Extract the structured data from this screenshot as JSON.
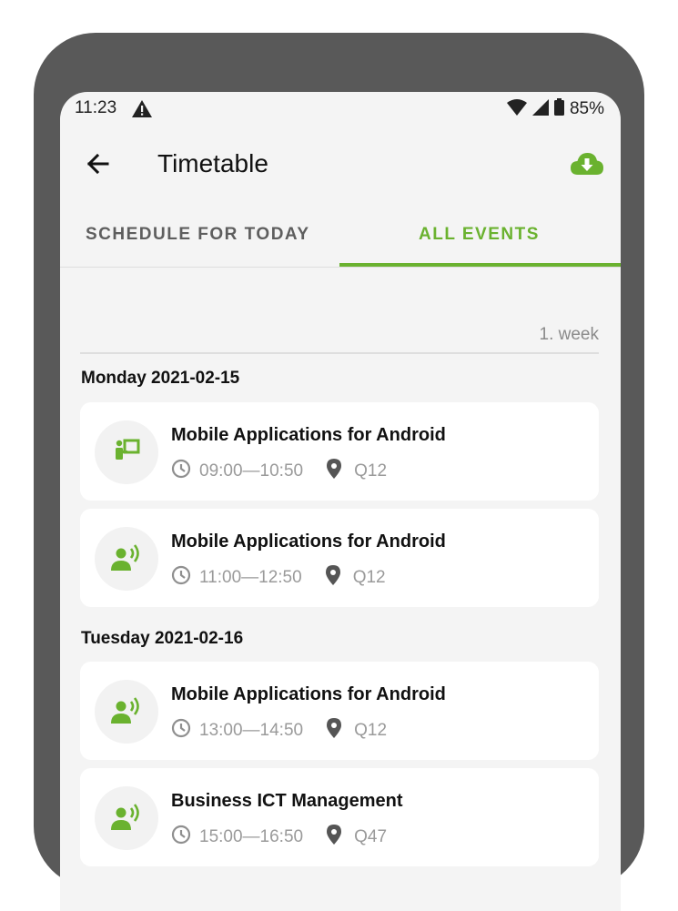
{
  "status_bar": {
    "time": "11:23",
    "battery": "85%"
  },
  "app_bar": {
    "title": "Timetable",
    "back_icon": "arrow-left",
    "action_icon": "cloud-download"
  },
  "tabs": [
    {
      "label": "SCHEDULE FOR TODAY",
      "selected": false
    },
    {
      "label": "ALL EVENTS",
      "selected": true
    }
  ],
  "week_label": "1. week",
  "days": [
    {
      "label": "Monday 2021-02-15",
      "events": [
        {
          "icon": "lecture-presentation",
          "name": "Mobile Applications for Android",
          "time": "09:00—10:50",
          "room": "Q12"
        },
        {
          "icon": "speaker-person",
          "name": "Mobile Applications for Android",
          "time": "11:00—12:50",
          "room": "Q12"
        }
      ]
    },
    {
      "label": "Tuesday 2021-02-16",
      "events": [
        {
          "icon": "speaker-person",
          "name": "Mobile Applications for Android",
          "time": "13:00—14:50",
          "room": "Q12"
        },
        {
          "icon": "speaker-person",
          "name": "Business ICT Management",
          "time": "15:00—16:50",
          "room": "Q47"
        }
      ]
    }
  ],
  "colors": {
    "accent": "#6ab22f",
    "frame": "#595959",
    "background": "#f4f4f4",
    "card": "#ffffff"
  }
}
